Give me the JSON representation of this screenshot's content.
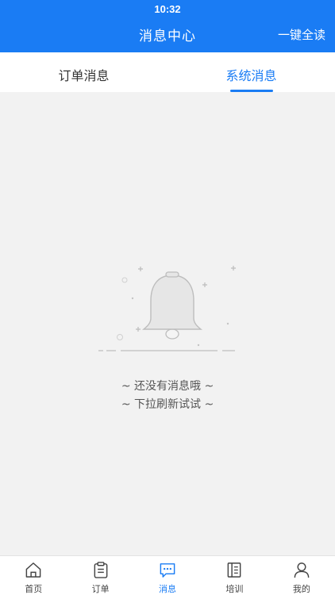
{
  "status_bar": {
    "time": "10:32"
  },
  "header": {
    "title": "消息中心",
    "read_all": "一键全读"
  },
  "tabs": [
    {
      "label": "订单消息",
      "active": false
    },
    {
      "label": "系统消息",
      "active": true
    }
  ],
  "empty_state": {
    "icon": "bell-icon",
    "line1": "~ 还没有消息哦 ~",
    "line2": "~ 下拉刷新试试 ~"
  },
  "bottom_nav": [
    {
      "label": "首页",
      "icon": "home-icon",
      "active": false
    },
    {
      "label": "订单",
      "icon": "clipboard-icon",
      "active": false
    },
    {
      "label": "消息",
      "icon": "chat-icon",
      "active": true
    },
    {
      "label": "培训",
      "icon": "book-icon",
      "active": false
    },
    {
      "label": "我的",
      "icon": "user-icon",
      "active": false
    }
  ],
  "colors": {
    "accent": "#1a7cf4",
    "background": "#f2f2f2"
  }
}
